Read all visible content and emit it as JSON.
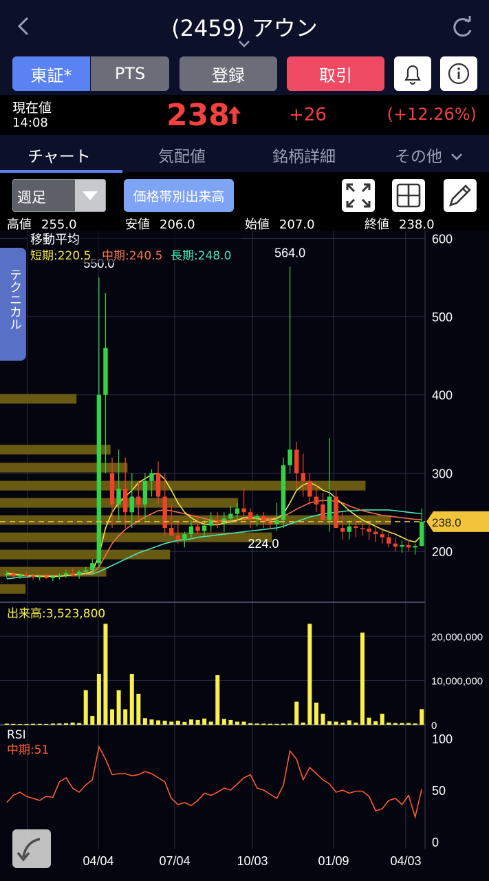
{
  "header": {
    "title": "(2459) アウン"
  },
  "toolbar": {
    "market_label": "東証*",
    "pts_label": "PTS",
    "register_label": "登録",
    "trade_label": "取引"
  },
  "quote": {
    "current_label": "現在値",
    "time": "14:08",
    "price": "238",
    "change": "+26",
    "change_pct": "(+12.26%)"
  },
  "tabs": [
    "チャート",
    "気配値",
    "銘柄詳細",
    "その他"
  ],
  "controls": {
    "period": "週足",
    "volume_profile_label": "価格帯別出来高"
  },
  "ohlc": [
    {
      "label": "高値",
      "value": "255.0"
    },
    {
      "label": "安値",
      "value": "206.0"
    },
    {
      "label": "始値",
      "value": "207.0"
    },
    {
      "label": "終値",
      "value": "238.0"
    }
  ],
  "side_tab": "テクニカル",
  "colors": {
    "up": "#32d24b",
    "down": "#f0412b",
    "short_ma": "#f2e64b",
    "mid_ma": "#f2734b",
    "long_ma": "#4be6b4",
    "rsi": "#ff5a32",
    "volume": "#f8f04b",
    "profile": "#6e5f14"
  },
  "chart_data": {
    "type": "candlestick",
    "ma_title": "移動平均",
    "ma_labels": {
      "short": "短期:220.5",
      "mid": "中期:240.5",
      "long": "長期:248.0"
    },
    "price_axis": {
      "ticks": [
        200,
        300,
        400,
        500,
        600
      ],
      "ylim": [
        135,
        610
      ]
    },
    "x_ticks": [
      "04/04",
      "07/04",
      "10/03",
      "01/09",
      "04/03"
    ],
    "annotations": [
      "550.0",
      "564.0",
      "224.0"
    ],
    "current_price_tag": "238.0",
    "candles": [
      [
        170,
        175,
        166,
        171
      ],
      [
        171,
        173,
        167,
        168
      ],
      [
        168,
        172,
        165,
        170
      ],
      [
        170,
        174,
        167,
        169
      ],
      [
        169,
        171,
        164,
        167
      ],
      [
        167,
        170,
        163,
        168
      ],
      [
        168,
        171,
        165,
        166
      ],
      [
        166,
        170,
        162,
        168
      ],
      [
        168,
        172,
        164,
        170
      ],
      [
        170,
        176,
        166,
        172
      ],
      [
        172,
        178,
        168,
        170
      ],
      [
        170,
        176,
        165,
        174
      ],
      [
        174,
        180,
        170,
        176
      ],
      [
        176,
        190,
        170,
        185
      ],
      [
        185,
        550,
        180,
        400
      ],
      [
        400,
        530,
        300,
        460
      ],
      [
        300,
        320,
        230,
        260
      ],
      [
        260,
        330,
        240,
        280
      ],
      [
        280,
        320,
        230,
        250
      ],
      [
        250,
        300,
        230,
        270
      ],
      [
        270,
        290,
        240,
        260
      ],
      [
        260,
        300,
        240,
        290
      ],
      [
        290,
        305,
        270,
        300
      ],
      [
        300,
        315,
        260,
        270
      ],
      [
        270,
        300,
        220,
        230
      ],
      [
        230,
        260,
        220,
        220
      ],
      [
        220,
        240,
        210,
        215
      ],
      [
        215,
        225,
        205,
        222
      ],
      [
        222,
        240,
        215,
        232
      ],
      [
        232,
        245,
        222,
        226
      ],
      [
        226,
        240,
        220,
        233
      ],
      [
        233,
        250,
        225,
        240
      ],
      [
        240,
        250,
        230,
        236
      ],
      [
        236,
        250,
        225,
        242
      ],
      [
        242,
        258,
        235,
        248
      ],
      [
        248,
        262,
        240,
        255
      ],
      [
        255,
        280,
        245,
        250
      ],
      [
        250,
        255,
        230,
        242
      ],
      [
        242,
        248,
        232,
        245
      ],
      [
        245,
        250,
        230,
        238
      ],
      [
        238,
        244,
        228,
        235
      ],
      [
        235,
        262,
        226,
        240
      ],
      [
        240,
        320,
        230,
        310
      ],
      [
        310,
        564,
        300,
        330
      ],
      [
        330,
        340,
        280,
        300
      ],
      [
        300,
        325,
        270,
        290
      ],
      [
        290,
        300,
        260,
        270
      ],
      [
        270,
        285,
        250,
        260
      ],
      [
        260,
        275,
        240,
        240
      ],
      [
        240,
        345,
        225,
        270
      ],
      [
        270,
        280,
        230,
        230
      ],
      [
        230,
        250,
        215,
        225
      ],
      [
        225,
        240,
        215,
        232
      ],
      [
        232,
        240,
        218,
        230
      ],
      [
        230,
        238,
        220,
        229
      ],
      [
        229,
        236,
        215,
        225
      ],
      [
        225,
        232,
        212,
        222
      ],
      [
        222,
        230,
        210,
        218
      ],
      [
        218,
        226,
        205,
        210
      ],
      [
        210,
        218,
        200,
        206
      ],
      [
        206,
        214,
        198,
        208
      ],
      [
        208,
        215,
        200,
        205
      ],
      [
        205,
        210,
        196,
        207
      ],
      [
        207,
        255,
        206,
        238
      ]
    ],
    "ma": {
      "short": [
        172,
        171,
        170,
        169,
        169,
        168,
        168,
        168,
        168,
        169,
        170,
        171,
        172,
        174,
        195,
        230,
        250,
        262,
        270,
        278,
        288,
        293,
        298,
        300,
        292,
        278,
        262,
        250,
        243,
        238,
        235,
        234,
        234,
        236,
        238,
        240,
        243,
        244,
        242,
        240,
        240,
        242,
        248,
        262,
        278,
        285,
        288,
        284,
        278,
        275,
        268,
        260,
        252,
        246,
        240,
        236,
        232,
        228,
        225,
        222,
        218,
        214,
        212,
        220.5
      ],
      "mid": [
        170,
        170,
        170,
        169,
        169,
        169,
        169,
        169,
        169,
        169,
        170,
        170,
        171,
        172,
        180,
        195,
        210,
        220,
        228,
        234,
        239,
        244,
        248,
        252,
        253,
        252,
        250,
        248,
        246,
        244,
        242,
        240,
        239,
        239,
        239,
        240,
        241,
        242,
        242,
        242,
        242,
        243,
        245,
        249,
        254,
        258,
        262,
        264,
        265,
        265,
        264,
        262,
        258,
        255,
        252,
        250,
        248,
        246,
        245,
        244,
        243,
        242,
        241,
        240.5
      ],
      "long": [
        165,
        166,
        167,
        167,
        168,
        168,
        168,
        169,
        169,
        169,
        170,
        170,
        171,
        171,
        174,
        178,
        182,
        186,
        190,
        194,
        198,
        201,
        204,
        207,
        210,
        212,
        214,
        215,
        216,
        218,
        219,
        220,
        221,
        222,
        223,
        224,
        225,
        226,
        227,
        228,
        229,
        230,
        232,
        235,
        238,
        241,
        244,
        246,
        248,
        249,
        250,
        251,
        252,
        252,
        253,
        253,
        253,
        253,
        253,
        252,
        251,
        250,
        249,
        248.0
      ]
    },
    "volume_profile": [
      {
        "price": 240,
        "value": 0.92
      },
      {
        "price": 262,
        "value": 0.56
      },
      {
        "price": 284,
        "value": 0.86
      },
      {
        "price": 307,
        "value": 0.3
      },
      {
        "price": 330,
        "value": 0.26
      },
      {
        "price": 395,
        "value": 0.18
      },
      {
        "price": 218,
        "value": 0.64
      },
      {
        "price": 196,
        "value": 0.4
      },
      {
        "price": 174,
        "value": 0.25
      },
      {
        "price": 152,
        "value": 0.06
      }
    ],
    "volume_title": "出来高:3,523,800",
    "volume_axis": {
      "ticks": [
        "20,000,000",
        "10,000,000",
        "0"
      ],
      "max": 23000000
    },
    "volume": [
      250000,
      200000,
      150000,
      180000,
      220000,
      200000,
      180000,
      260000,
      300000,
      350000,
      500000,
      400000,
      7800000,
      2000000,
      11500000,
      22800000,
      3500000,
      7800000,
      3500000,
      11500000,
      7000000,
      1500000,
      1200000,
      1000000,
      900000,
      700000,
      900000,
      650000,
      1200000,
      1100000,
      1400000,
      700000,
      11200000,
      1300000,
      1100000,
      700000,
      700000,
      350000,
      280000,
      250000,
      220000,
      200000,
      240000,
      250000,
      5200000,
      500000,
      22800000,
      5000000,
      2500000,
      800000,
      700000,
      500000,
      1000000,
      500000,
      20800000,
      1600000,
      800000,
      2500000,
      500000,
      400000,
      400000,
      400000,
      300000,
      3523800
    ],
    "rsi_title": "RSI",
    "rsi_label": "中期:51",
    "rsi_axis": {
      "ticks": [
        "100",
        "50",
        "0"
      ]
    },
    "rsi": [
      38,
      45,
      48,
      44,
      42,
      40,
      44,
      43,
      58,
      62,
      52,
      48,
      55,
      60,
      92,
      80,
      65,
      66,
      66,
      64,
      65,
      68,
      66,
      62,
      58,
      42,
      36,
      38,
      35,
      40,
      47,
      45,
      48,
      52,
      50,
      56,
      62,
      65,
      52,
      50,
      46,
      42,
      55,
      88,
      80,
      60,
      72,
      66,
      60,
      56,
      48,
      50,
      47,
      49,
      49,
      44,
      30,
      32,
      40,
      42,
      36,
      45,
      24,
      51
    ]
  }
}
